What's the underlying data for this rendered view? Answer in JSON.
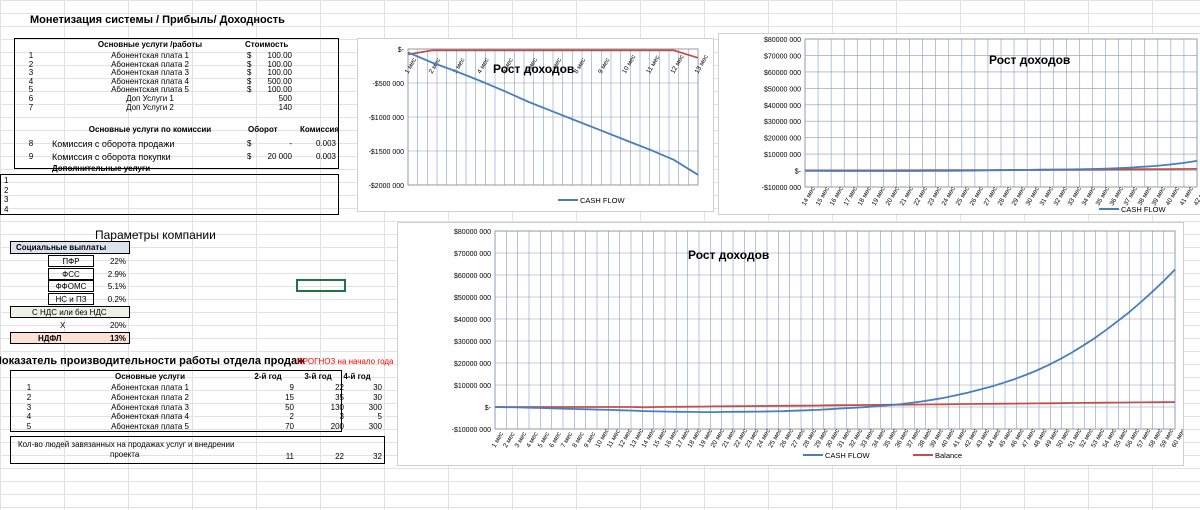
{
  "title": "Монетизация системы / Прибыль/ Доходность",
  "services": {
    "header_name": "Основные услуги /работы",
    "header_cost": "Стоимость",
    "rows": [
      {
        "num": "1",
        "name": "Абонентская плата 1",
        "cur": "$",
        "cost": "100.00"
      },
      {
        "num": "2",
        "name": "Абонентская плата 2",
        "cur": "$",
        "cost": "100.00"
      },
      {
        "num": "3",
        "name": "Абонентская плата 3",
        "cur": "$",
        "cost": "100.00"
      },
      {
        "num": "4",
        "name": "Абонентская плата 4",
        "cur": "$",
        "cost": "500.00"
      },
      {
        "num": "5",
        "name": "Абонентская плата 5",
        "cur": "$",
        "cost": "100.00"
      },
      {
        "num": "6",
        "name": "Доп Услуги 1",
        "cur": "",
        "cost": "500"
      },
      {
        "num": "7",
        "name": "Доп Услуги 2",
        "cur": "",
        "cost": "140"
      }
    ],
    "commission_header": "Основные услуги по комиссии",
    "turnover_header": "Оборот",
    "commission_col": "Комиссия",
    "commission_rows": [
      {
        "num": "8",
        "name": "Комиссия с оборота продажи",
        "cur": "$",
        "turnover": "-",
        "rate": "0.003"
      },
      {
        "num": "9",
        "name": "Комиссия с оборота покупки",
        "cur": "$",
        "turnover": "20 000",
        "rate": "0.003"
      }
    ],
    "extra_header": "Дополнительные услуги",
    "extra_nums": [
      "1",
      "2",
      "3",
      "4"
    ]
  },
  "company": {
    "title": "Параметры компании",
    "social_header": "Социальные выплаты",
    "rows": [
      {
        "label": "ПФР",
        "value": "22%"
      },
      {
        "label": "ФСС",
        "value": "2.9%"
      },
      {
        "label": "ФФОМС",
        "value": "5.1%"
      },
      {
        "label": "НС и ПЗ",
        "value": "0.2%"
      }
    ],
    "vat_header": "С НДС или без НДС",
    "vat_label": "Х",
    "vat_value": "20%",
    "ndfl_label": "НДФЛ",
    "ndfl_value": "13%"
  },
  "productivity": {
    "title": "Показатель производительности работы отдела продаж",
    "forecast_note": "ПРОГНОЗ на начало года",
    "col_service": "Основные услуги",
    "years": [
      "2-й год",
      "3-й год",
      "4-й год"
    ],
    "rows": [
      {
        "num": "1",
        "name": "Абонентская плата 1",
        "v": [
          "9",
          "22",
          "30"
        ]
      },
      {
        "num": "2",
        "name": "Абонентская плата 2",
        "v": [
          "15",
          "35",
          "30"
        ]
      },
      {
        "num": "3",
        "name": "Абонентская плата 3",
        "v": [
          "50",
          "130",
          "300"
        ]
      },
      {
        "num": "4",
        "name": "Абонентская плата 4",
        "v": [
          "2",
          "3",
          "5"
        ]
      },
      {
        "num": "5",
        "name": "Абонентская плата 5",
        "v": [
          "70",
          "200",
          "300"
        ]
      }
    ],
    "people_label_1": "Кол-во людей завязанных на продажах услуг и внедрении",
    "people_label_2": "проекта",
    "people_values": [
      "11",
      "22",
      "32"
    ]
  },
  "colors": {
    "cash_flow": "#4a7ebb",
    "balance": "#c0504d",
    "red_note": "#ff0000",
    "selection": "#217346"
  },
  "chart_data": [
    {
      "type": "line",
      "title": "Рост доходов",
      "categories": [
        "1 мес",
        "2 мес",
        "3 мес",
        "4 мес",
        "5 мес",
        "6 мес",
        "7 мес",
        "8 мес",
        "9 мес",
        "10 мес",
        "11 мес",
        "12 мес",
        "13 мес"
      ],
      "y_ticks": [
        "$-",
        "-$500 000",
        "-$1000 000",
        "-$1500 000",
        "-$2000 000"
      ],
      "ylim": [
        -2000000,
        0
      ],
      "series": [
        {
          "name": "CASH FLOW",
          "values": [
            -50000,
            -200000,
            -330000,
            -470000,
            -620000,
            -780000,
            -920000,
            -1060000,
            -1200000,
            -1340000,
            -1480000,
            -1630000,
            -1850000
          ]
        },
        {
          "name": "",
          "values": [
            -80000,
            -20000,
            -20000,
            -20000,
            -20000,
            -20000,
            -20000,
            -20000,
            -20000,
            -20000,
            -20000,
            -20000,
            -130000
          ]
        }
      ],
      "legend": [
        "CASH FLOW"
      ]
    },
    {
      "type": "line",
      "title": "Рост доходов",
      "categories": [
        "14 мес",
        "15 мес",
        "16 мес",
        "17 мес",
        "18 мес",
        "19 мес",
        "20 мес",
        "21 мес",
        "22 мес",
        "23 мес",
        "24 мес",
        "25 мес",
        "26 мес",
        "27 мес",
        "28 мес",
        "29 мес",
        "30 мес",
        "31 мес",
        "32 мес",
        "33 мес",
        "34 мес",
        "35 мес",
        "36 мес",
        "37 мес",
        "38 мес",
        "39 мес",
        "40 мес",
        "41 мес",
        "42 мес"
      ],
      "y_ticks": [
        "$80000 000",
        "$70000 000",
        "$60000 000",
        "$50000 000",
        "$40000 000",
        "$30000 000",
        "$20000 000",
        "$10000 000",
        "$-",
        "-$10000 000"
      ],
      "ylim": [
        -10000000,
        80000000
      ],
      "series": [
        {
          "name": "CASH FLOW",
          "values": [
            -200000,
            -200000,
            -250000,
            -300000,
            -300000,
            -300000,
            -300000,
            -300000,
            -250000,
            -200000,
            -150000,
            -100000,
            0,
            100000,
            200000,
            300000,
            400000,
            500000,
            600000,
            700000,
            800000,
            1000000,
            1300000,
            1700000,
            2200000,
            2800000,
            3600000,
            4600000,
            5900000
          ]
        },
        {
          "name": "",
          "values": [
            100000,
            100000,
            100000,
            100000,
            100000,
            100000,
            100000,
            150000,
            150000,
            200000,
            200000,
            250000,
            300000,
            300000,
            350000,
            400000,
            400000,
            450000,
            500000,
            550000,
            600000,
            650000,
            700000,
            750000,
            800000,
            900000,
            900000,
            950000,
            1000000
          ]
        }
      ],
      "legend": [
        "CASH FLOW"
      ]
    },
    {
      "type": "line",
      "title": "Рост доходов",
      "categories": [
        "1 мес",
        "2 мес",
        "3 мес",
        "4 мес",
        "5 мес",
        "6 мес",
        "7 мес",
        "8 мес",
        "9 мес",
        "10 мес",
        "11 мес",
        "12 мес",
        "13 мес",
        "14 мес",
        "15 мес",
        "16 мес",
        "17 мес",
        "18 мес",
        "19 мес",
        "20 мес",
        "21 мес",
        "22 мес",
        "23 мес",
        "24 мес",
        "25 мес",
        "26 мес",
        "27 мес",
        "28 мес",
        "29 мес",
        "30 мес",
        "31 мес",
        "32 мес",
        "33 мес",
        "34 мес",
        "35 мес",
        "36 мес",
        "37 мес",
        "38 мес",
        "39 мес",
        "40 мес",
        "41 мес",
        "42 мес",
        "43 мес",
        "44 мес",
        "45 мес",
        "46 мес",
        "47 мес",
        "48 мес",
        "49 мес",
        "50 мес",
        "51 мес",
        "52 мес",
        "53 мес",
        "54 мес",
        "55 мес",
        "56 мес",
        "57 мес",
        "58 мес",
        "59 мес",
        "60 мес"
      ],
      "y_ticks": [
        "$80000 000",
        "$70000 000",
        "$60000 000",
        "$50000 000",
        "$40000 000",
        "$30000 000",
        "$20000 000",
        "$10000 000",
        "$-",
        "-$10000 000"
      ],
      "ylim": [
        -10000000,
        80000000
      ],
      "series": [
        {
          "name": "CASH FLOW",
          "values": [
            0,
            -50000,
            -200000,
            -330000,
            -470000,
            -620000,
            -780000,
            -920000,
            -1060000,
            -1200000,
            -1340000,
            -1480000,
            -1630000,
            -1850000,
            -2000000,
            -2100000,
            -2200000,
            -2250000,
            -2300000,
            -2300000,
            -2250000,
            -2200000,
            -2150000,
            -2100000,
            -2000000,
            -1900000,
            -1700000,
            -1500000,
            -1300000,
            -1000000,
            -700000,
            -400000,
            -100000,
            300000,
            700000,
            1200000,
            1800000,
            2500000,
            3300000,
            4200000,
            5300000,
            6500000,
            7800000,
            9200000,
            10800000,
            12500000,
            14500000,
            16600000,
            19000000,
            21700000,
            24600000,
            27800000,
            31200000,
            34900000,
            38900000,
            43000000,
            47500000,
            52200000,
            57200000,
            62500000
          ]
        },
        {
          "name": "Balance",
          "values": [
            0,
            -80000,
            -20000,
            -20000,
            -20000,
            -20000,
            -20000,
            -20000,
            -20000,
            -20000,
            -20000,
            -20000,
            -20000,
            -130000,
            0,
            50000,
            100000,
            150000,
            200000,
            250000,
            300000,
            350000,
            400000,
            450000,
            500000,
            550000,
            600000,
            650000,
            700000,
            750000,
            800000,
            850000,
            900000,
            950000,
            1000000,
            1050000,
            1100000,
            1150000,
            1200000,
            1250000,
            1300000,
            1350000,
            1400000,
            1450000,
            1500000,
            1550000,
            1600000,
            1650000,
            1700000,
            1750000,
            1800000,
            1850000,
            1900000,
            1950000,
            2000000,
            2050000,
            2100000,
            2150000,
            2200000,
            2250000
          ]
        }
      ],
      "legend": [
        "CASH FLOW",
        "Balance"
      ]
    }
  ]
}
